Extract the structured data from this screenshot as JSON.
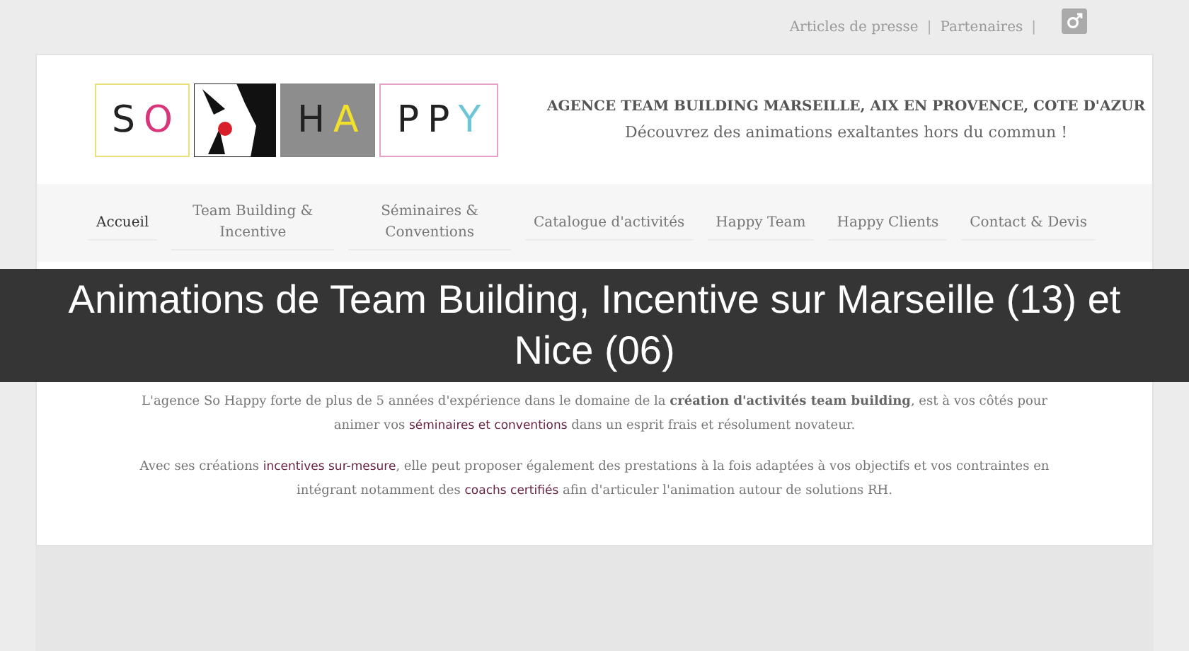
{
  "top_links": [
    "Articles de presse",
    "Partenaires"
  ],
  "top_separator": "|",
  "logo": {
    "boxes": [
      {
        "kind": "letters",
        "color": "#e8e07a",
        "letters": [
          {
            "char": "S",
            "color": "#222222"
          },
          {
            "char": "O",
            "color": "#d8357a"
          }
        ]
      },
      {
        "kind": "illustration"
      },
      {
        "kind": "letters",
        "color": "#8a8a8a",
        "letters": [
          {
            "char": "H",
            "color": "#222222"
          },
          {
            "char": "A",
            "color": "#f2e12a"
          }
        ]
      },
      {
        "kind": "letters",
        "color": "#e6a0c4",
        "letters": [
          {
            "char": "P",
            "color": "#222222"
          },
          {
            "char": "P",
            "color": "#222222"
          },
          {
            "char": "Y",
            "color": "#6cc6d6"
          }
        ]
      }
    ]
  },
  "header": {
    "title": "AGENCE TEAM BUILDING MARSEILLE, AIX EN PROVENCE, COTE D'AZUR",
    "subtitle": "Découvrez des animations exaltantes hors du commun !"
  },
  "nav": [
    {
      "label": "Accueil",
      "selected": true
    },
    {
      "label": "Team Building & Incentive",
      "selected": false
    },
    {
      "label": "Séminaires & Conventions",
      "selected": false
    },
    {
      "label": "Catalogue d'activités",
      "selected": false
    },
    {
      "label": "Happy Team",
      "selected": false
    },
    {
      "label": "Happy Clients",
      "selected": false
    },
    {
      "label": "Contact & Devis",
      "selected": false
    }
  ],
  "banner": "Animations de Team Building, Incentive sur Marseille (13) et Nice (06)",
  "paragraphs": [
    [
      {
        "kind": "plain",
        "text": "L'agence So Happy forte de plus de 5 années d'expérience dans le domaine de la "
      },
      {
        "kind": "bold",
        "text": "création d'activités team building"
      },
      {
        "kind": "plain",
        "text": ", est à vos côtés pour animer vos "
      },
      {
        "kind": "link",
        "text": "séminaires et conventions"
      },
      {
        "kind": "plain",
        "text": " dans un esprit frais et résolument novateur."
      }
    ],
    [
      {
        "kind": "plain",
        "text": "Avec ses créations "
      },
      {
        "kind": "link",
        "text": "incentives sur-mesure"
      },
      {
        "kind": "plain",
        "text": ", elle peut proposer également des prestations à la fois adaptées à vos objectifs et vos contraintes en intégrant notamment des "
      },
      {
        "kind": "link",
        "text": "coachs certifiés"
      },
      {
        "kind": "plain",
        "text": " afin d'articuler l'animation autour de solutions RH."
      }
    ]
  ]
}
